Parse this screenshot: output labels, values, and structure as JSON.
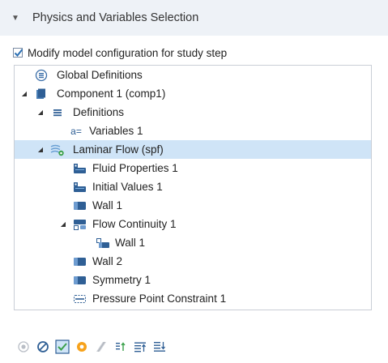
{
  "section": {
    "title": "Physics and Variables Selection",
    "caret_icon": "triangle-down-icon"
  },
  "checkbox": {
    "label": "Modify model configuration for study step",
    "checked": true
  },
  "tree": {
    "nodes": [
      {
        "label": "Global Definitions",
        "icon": "global-definitions-icon",
        "expander": "none"
      },
      {
        "label": "Component 1 (comp1)",
        "icon": "component-icon",
        "expander": "expanded"
      },
      {
        "label": "Definitions",
        "icon": "definitions-icon",
        "expander": "expanded"
      },
      {
        "label": "Variables 1",
        "icon": "variables-icon",
        "expander": "none"
      },
      {
        "label": "Laminar Flow (spf)",
        "icon": "laminar-flow-icon",
        "expander": "expanded",
        "selected": true
      },
      {
        "label": "Fluid Properties 1",
        "icon": "fluid-properties-icon",
        "expander": "none"
      },
      {
        "label": "Initial Values 1",
        "icon": "initial-values-icon",
        "expander": "none"
      },
      {
        "label": "Wall 1",
        "icon": "wall-icon",
        "expander": "none"
      },
      {
        "label": "Flow Continuity 1",
        "icon": "flow-continuity-icon",
        "expander": "expanded"
      },
      {
        "label": "Wall 1",
        "icon": "wall-sub-icon",
        "expander": "none"
      },
      {
        "label": "Wall 2",
        "icon": "wall-icon",
        "expander": "none"
      },
      {
        "label": "Symmetry 1",
        "icon": "symmetry-icon",
        "expander": "none"
      },
      {
        "label": "Pressure Point Constraint 1",
        "icon": "pressure-point-icon",
        "expander": "none"
      }
    ]
  },
  "toolbar": {
    "buttons": [
      {
        "name": "enable-button",
        "icon": "radio-dot-icon"
      },
      {
        "name": "disable-button",
        "icon": "circle-slash-icon"
      },
      {
        "name": "solve-for-button",
        "icon": "checkbox-checked-icon"
      },
      {
        "name": "disable-in-solvers-button",
        "icon": "orange-dot-icon"
      },
      {
        "name": "disable-in-model-button",
        "icon": "diagonal-hatch-icon"
      },
      {
        "name": "load-values-button",
        "icon": "load-list-icon"
      },
      {
        "name": "sort-up-button",
        "icon": "list-up-icon"
      },
      {
        "name": "sort-down-button",
        "icon": "list-down-icon"
      }
    ]
  },
  "colors": {
    "header_bg": "#eef2f7",
    "selected_bg": "#cfe4f7",
    "accent_blue": "#2a6fb3",
    "check_blue": "#2a6fb3"
  }
}
